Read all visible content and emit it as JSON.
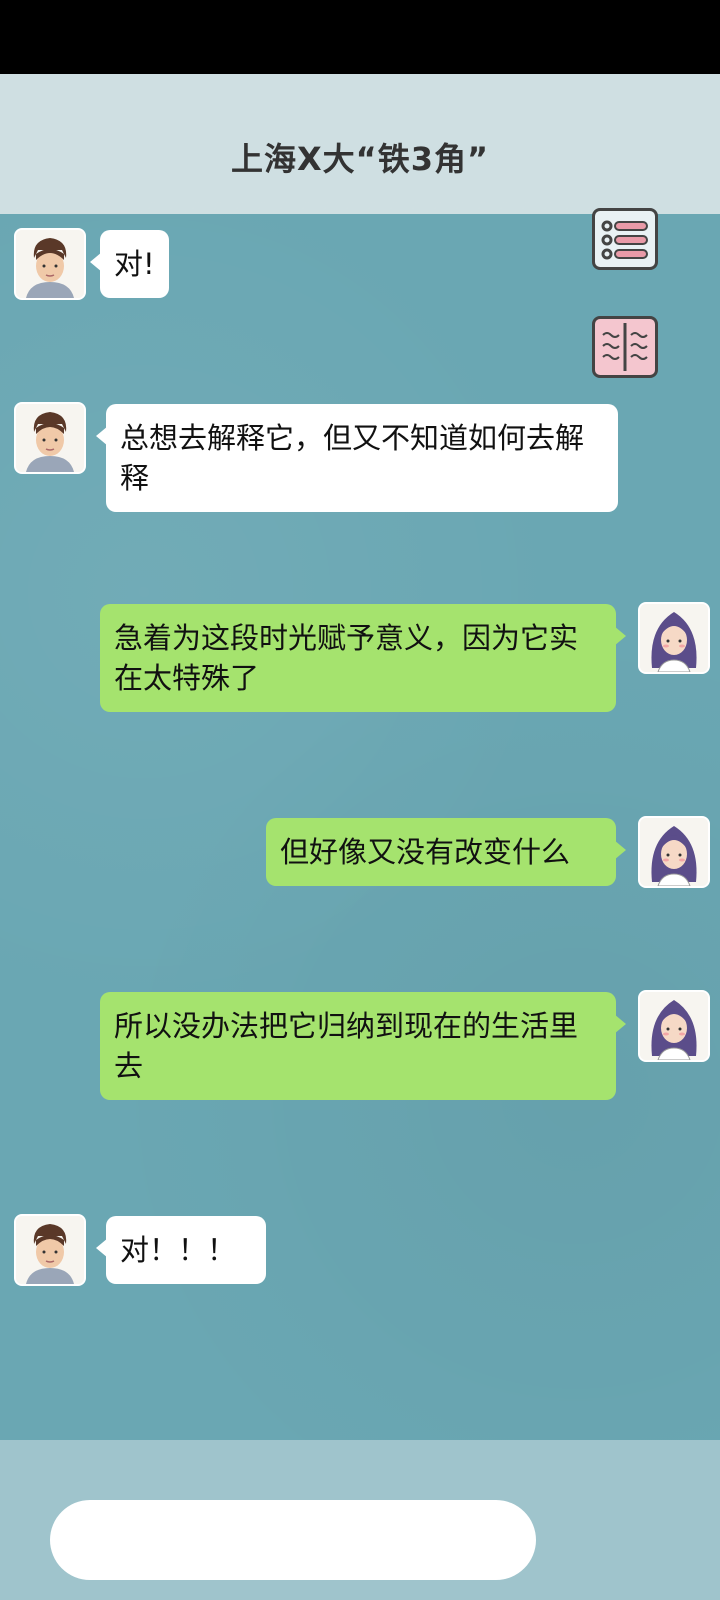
{
  "header": {
    "title": "上海X大“铁3角”"
  },
  "side_buttons": {
    "menu_icon": "list-menu-icon",
    "book_icon": "open-book-icon"
  },
  "messages": [
    {
      "side": "left",
      "avatar": "boy-avatar",
      "text": "对!"
    },
    {
      "side": "left",
      "avatar": "boy-avatar",
      "text": "总想去解释它，但又不知道如何去解释"
    },
    {
      "side": "right",
      "avatar": "girl-avatar",
      "text": "急着为这段时光赋予意义，因为它实在太特殊了"
    },
    {
      "side": "right",
      "avatar": "girl-avatar",
      "text": "但好像又没有改变什么"
    },
    {
      "side": "right",
      "avatar": "girl-avatar",
      "text": "所以没办法把它归纳到现在的生活里去"
    },
    {
      "side": "left",
      "avatar": "boy-avatar",
      "text": "对！！！"
    }
  ],
  "input": {
    "placeholder": ""
  },
  "colors": {
    "chat_bg": "#6aa7b3",
    "right_bubble": "#a5e36e",
    "left_bubble": "#ffffff",
    "header_bg": "#cfdfe2"
  }
}
